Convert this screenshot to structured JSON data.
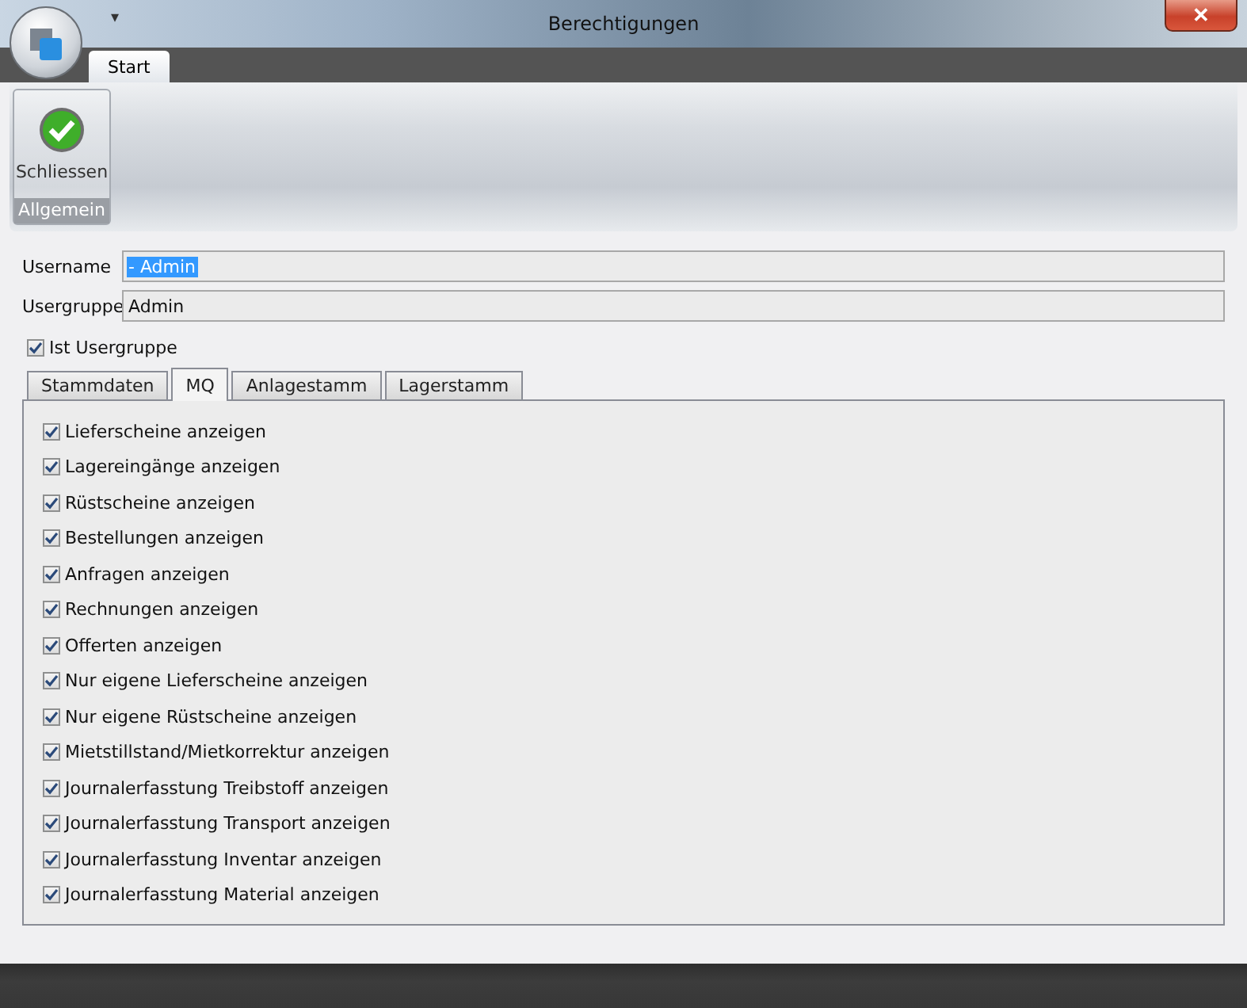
{
  "window": {
    "title": "Berechtigungen",
    "close": "✕",
    "quick_access": "▾"
  },
  "ribbon": {
    "tabs": [
      {
        "label": "Start",
        "selected": true
      }
    ],
    "groups": [
      {
        "label": "Allgemein",
        "buttons": [
          {
            "label": "Schliessen"
          }
        ]
      }
    ]
  },
  "form": {
    "fields": [
      {
        "label": "Username",
        "value": "- Admin",
        "selected": true
      },
      {
        "label": "Usergruppe",
        "value": "Admin",
        "selected": false
      }
    ],
    "is_group": {
      "label": "Ist Usergruppe",
      "checked": true
    }
  },
  "tabs": [
    {
      "label": "Stammdaten",
      "selected": false
    },
    {
      "label": "MQ",
      "selected": true
    },
    {
      "label": "Anlagestamm",
      "selected": false
    },
    {
      "label": "Lagerstamm",
      "selected": false
    }
  ],
  "permissions": [
    {
      "label": "Lieferscheine anzeigen",
      "checked": true
    },
    {
      "label": "Lagereingänge anzeigen",
      "checked": true
    },
    {
      "label": "Rüstscheine anzeigen",
      "checked": true
    },
    {
      "label": "Bestellungen anzeigen",
      "checked": true
    },
    {
      "label": "Anfragen anzeigen",
      "checked": true
    },
    {
      "label": "Rechnungen anzeigen",
      "checked": true
    },
    {
      "label": "Offerten anzeigen",
      "checked": true
    },
    {
      "label": "Nur eigene Lieferscheine anzeigen",
      "checked": true
    },
    {
      "label": "Nur eigene Rüstscheine anzeigen",
      "checked": true
    },
    {
      "label": "Mietstillstand/Mietkorrektur anzeigen",
      "checked": true
    },
    {
      "label": "Journalerfasstung Treibstoff anzeigen",
      "checked": true
    },
    {
      "label": "Journalerfasstung Transport anzeigen",
      "checked": true
    },
    {
      "label": "Journalerfasstung Inventar anzeigen",
      "checked": true
    },
    {
      "label": "Journalerfasstung Material anzeigen",
      "checked": true
    }
  ]
}
